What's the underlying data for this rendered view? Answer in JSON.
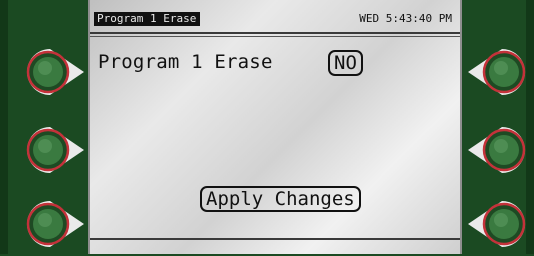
{
  "status_bar": {
    "screen_title": "Program 1 Erase",
    "clock": "WED 5:43:40 PM"
  },
  "main": {
    "field_label": "Program 1 Erase",
    "field_value": "NO",
    "apply_button_label": "Apply Changes"
  },
  "softkeys": {
    "left": [
      "left-softkey-1",
      "left-softkey-2",
      "left-softkey-3"
    ],
    "right": [
      "right-softkey-1",
      "right-softkey-2",
      "right-softkey-3"
    ]
  },
  "colors": {
    "bezel": "#1b4a22",
    "key_face": "#2f6b35",
    "key_ring": "#c4323a",
    "lcd_text": "#111111"
  }
}
